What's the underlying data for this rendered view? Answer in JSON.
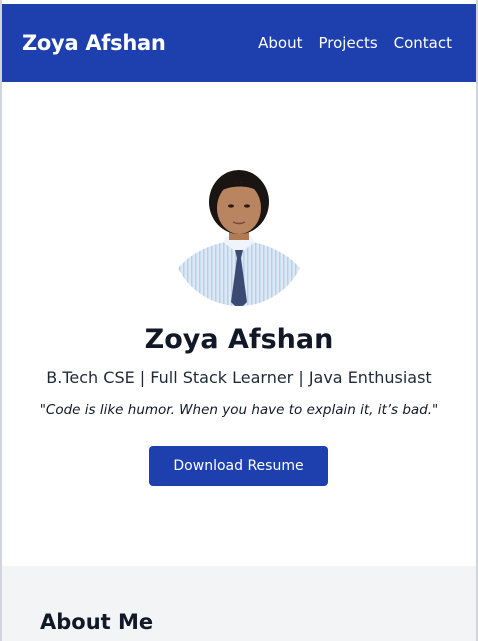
{
  "header": {
    "brand": "Zoya Afshan",
    "nav": [
      "About",
      "Projects",
      "Contact"
    ],
    "bg_color": "#1e40af"
  },
  "hero": {
    "avatar_icon": "profile-photo",
    "name": "Zoya Afshan",
    "tagline": "B.Tech CSE | Full Stack Learner | Java Enthusiast",
    "quote": "\"Code is like humor. When you have to explain it, it’s bad.\"",
    "resume_button": "Download Resume",
    "button_color": "#1e40af"
  },
  "about": {
    "title": "About Me"
  }
}
